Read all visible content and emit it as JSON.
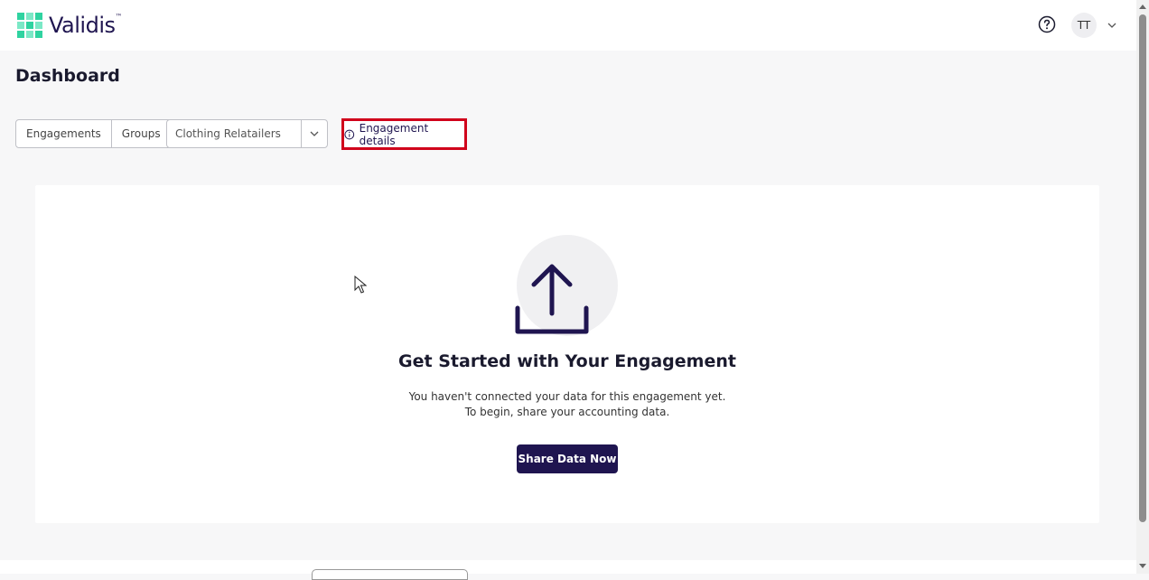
{
  "brand": {
    "name": "Validis",
    "trademark": "™"
  },
  "header": {
    "avatar_initials": "TT"
  },
  "page": {
    "title": "Dashboard"
  },
  "toolbar": {
    "segment_engagements": "Engagements",
    "segment_groups": "Groups",
    "engagement_select_value": "Clothing Relatailers",
    "details_label": "Engagement details"
  },
  "empty_state": {
    "title": "Get Started with Your Engagement",
    "line1": "You haven't connected your data for this engagement yet.",
    "line2": "To begin, share your accounting data.",
    "button_label": "Share Data Now"
  },
  "icons": [
    "validis-logo-icon",
    "help-icon",
    "chevron-down-icon",
    "info-icon",
    "upload-icon",
    "cursor-icon"
  ],
  "colors": {
    "brand_primary": "#1f1550",
    "highlight": "#d0021b",
    "logo_green": "#2fd3a0"
  }
}
